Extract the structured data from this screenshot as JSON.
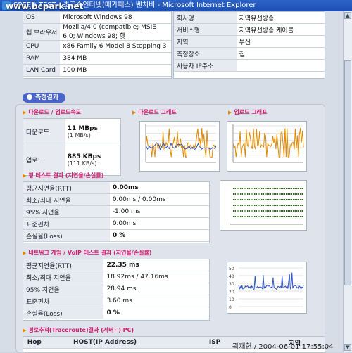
{
  "window": {
    "title": "SPEED TEST - 초고속인터넷(메가패스) 벤치비 - Microsoft Internet Explorer",
    "watermark": "www.bcpark.net"
  },
  "system_info": {
    "left": [
      {
        "key": "OS",
        "value": "Microsoft Windows 98"
      },
      {
        "key": "웹 브라우저",
        "value": "Mozilla/4.0 (compatible; MSIE 6.0; Windows 98; 햇"
      },
      {
        "key": "CPU",
        "value": "x86 Family 6 Model 8 Stepping 3"
      },
      {
        "key": "RAM",
        "value": "384 MB"
      },
      {
        "key": "LAN Card",
        "value": "100 MB"
      }
    ],
    "right": [
      {
        "key": "회사명",
        "value": "지역유선방송"
      },
      {
        "key": "서비스명",
        "value": "지역유선방송 케이블"
      },
      {
        "key": "지역",
        "value": "부산"
      },
      {
        "key": "측정장소",
        "value": "집"
      },
      {
        "key": "사용자 IP주소",
        "value": ""
      }
    ]
  },
  "results": {
    "section_title": "측정결과",
    "speed": {
      "label": "다운로드 / 업로드속도",
      "download_label": "다운로드",
      "download_value": "11 MBps",
      "download_sub": "(1 MB/s)",
      "upload_label": "업로드",
      "upload_value": "885 KBps",
      "upload_sub": "(111 KB/s)"
    },
    "download_graph_label": "다운로드 그래프",
    "upload_graph_label": "업로드 그래프",
    "ping": {
      "label": "핑 테스트 결과 (지연율/손실률)",
      "rows": [
        {
          "key": "평균지연율(RTT)",
          "value": "0.00ms"
        },
        {
          "key": "최소/최대 지연율",
          "value": "0.00ms / 0.00ms"
        },
        {
          "key": "95% 지연율",
          "value": "-1.00 ms"
        },
        {
          "key": "표준편차",
          "value": "0.00ms"
        },
        {
          "key": "손실율(Loss)",
          "value": "0 %"
        }
      ]
    },
    "voip": {
      "label": "네트워크 게임 / VoIP 테스트 결과 (지연율/손실률)",
      "rows": [
        {
          "key": "평균지연율(RTT)",
          "value": "22.35 ms"
        },
        {
          "key": "최소/최대 지연율",
          "value": "18.92ms / 47.16ms"
        },
        {
          "key": "95% 지연율",
          "value": "28.94 ms"
        },
        {
          "key": "표준편차",
          "value": "3.60 ms"
        },
        {
          "key": "손실율(Loss)",
          "value": "0 %"
        }
      ],
      "y_ticks": [
        "50",
        "40",
        "30",
        "20",
        "10",
        "0"
      ]
    },
    "traceroute": {
      "label": "경로추적(Traceroute)결과 (서버~) PC)",
      "columns": [
        "Hop",
        "HOST(IP Address)",
        "ISP",
        "지역"
      ]
    }
  },
  "footer": "곽재헌 / 2004-06-01 17:55:04"
}
